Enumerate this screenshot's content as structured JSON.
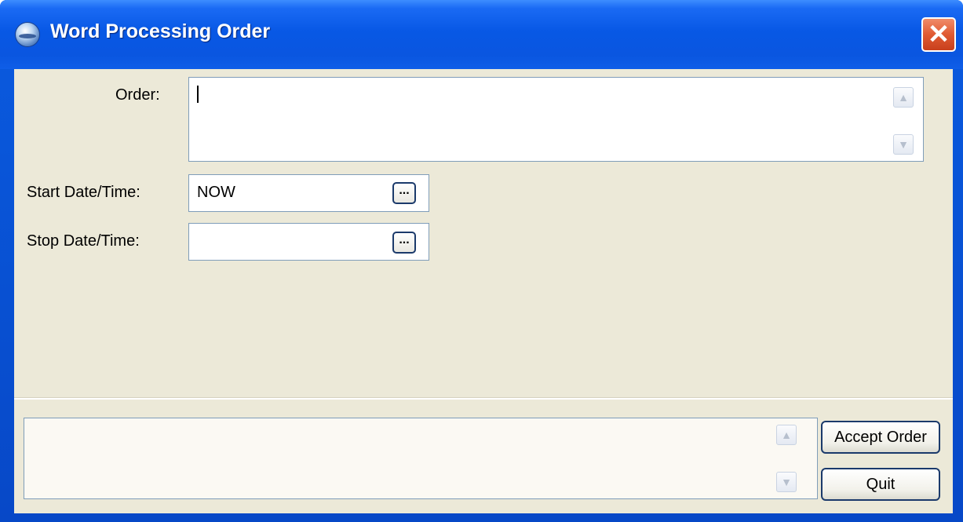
{
  "window": {
    "title": "Word Processing Order",
    "close_glyph": "✕",
    "app_icon": "globe-icon"
  },
  "form": {
    "order_label": "Order:",
    "order_value": "",
    "start_label": "Start Date/Time:",
    "start_value": "NOW",
    "stop_label": "Stop Date/Time:",
    "stop_value": "",
    "picker_glyph": "..."
  },
  "scroll": {
    "up_glyph": "▲",
    "down_glyph": "▼"
  },
  "actions": {
    "accept_label": "Accept Order",
    "quit_label": "Quit"
  },
  "colors": {
    "titlebar": "#0a56e0",
    "client": "#ece9d8",
    "close": "#e05a32"
  }
}
